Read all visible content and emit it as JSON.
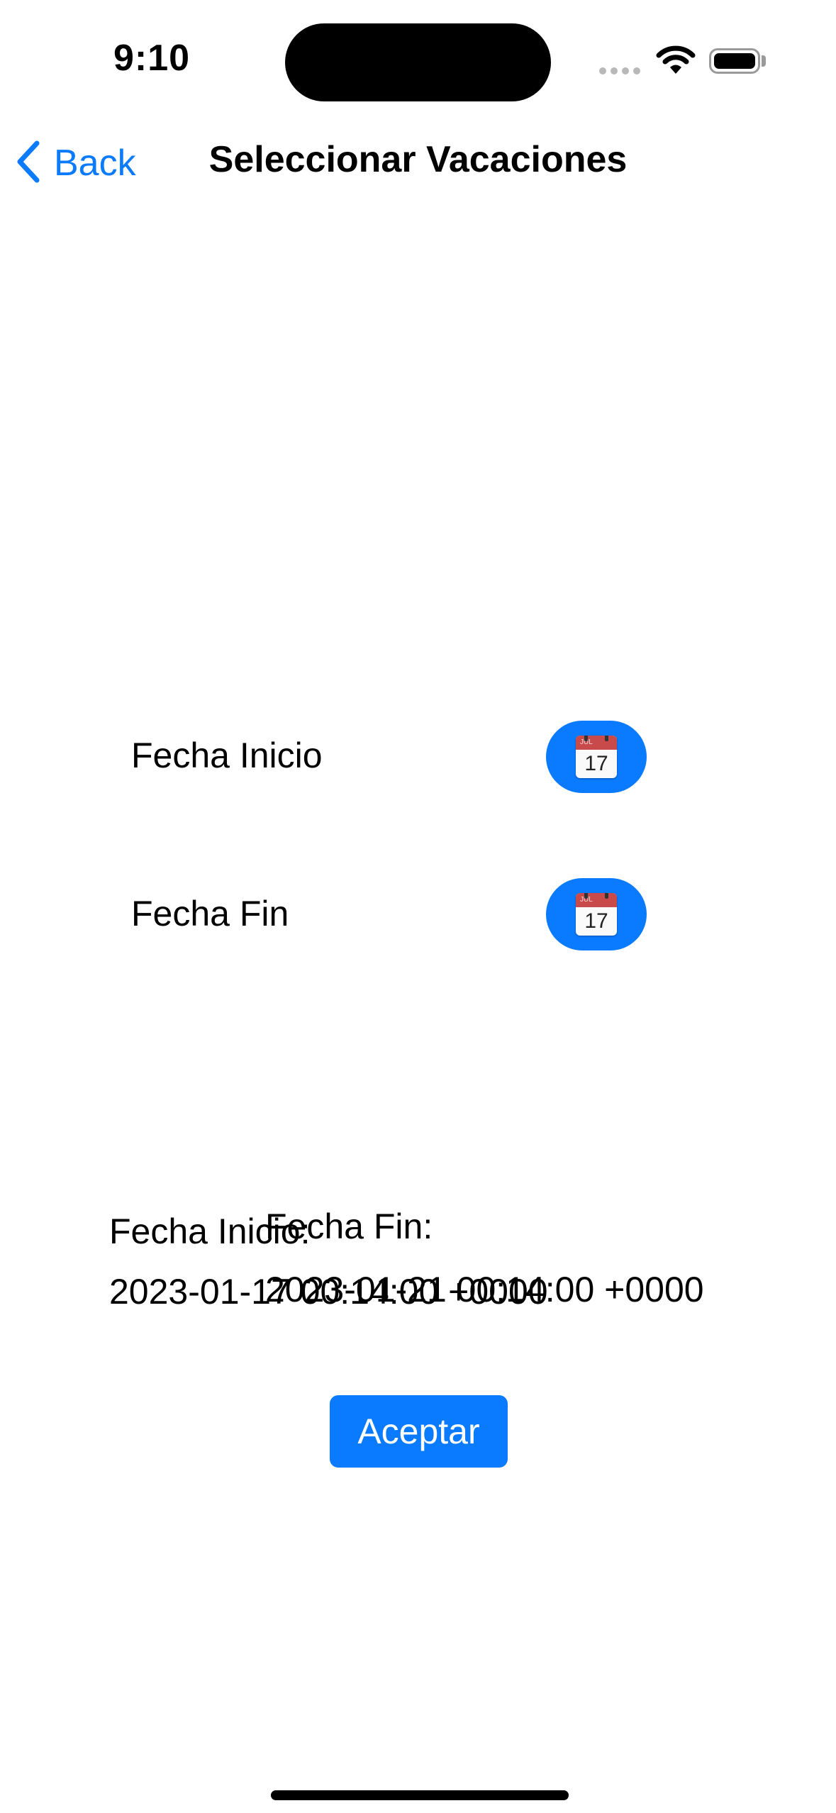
{
  "status_bar": {
    "time": "9:10",
    "icons": [
      "signal-icon",
      "wifi-icon",
      "battery-icon"
    ]
  },
  "nav": {
    "back_label": "Back",
    "title": "Seleccionar Vacaciones",
    "accent_color": "#0a7aff"
  },
  "rows": {
    "start_label": "Fecha Inicio",
    "end_label": "Fecha Fin",
    "calendar_icon_month": "JUL",
    "calendar_icon_day": "17"
  },
  "summary": {
    "start_label": "Fecha Inicio:",
    "start_value": "2023-01-17 00:14:00 +0000",
    "end_label": "Fecha Fin:",
    "end_value": "2023-01-21 00:14:00 +0000"
  },
  "accept_label": "Aceptar"
}
